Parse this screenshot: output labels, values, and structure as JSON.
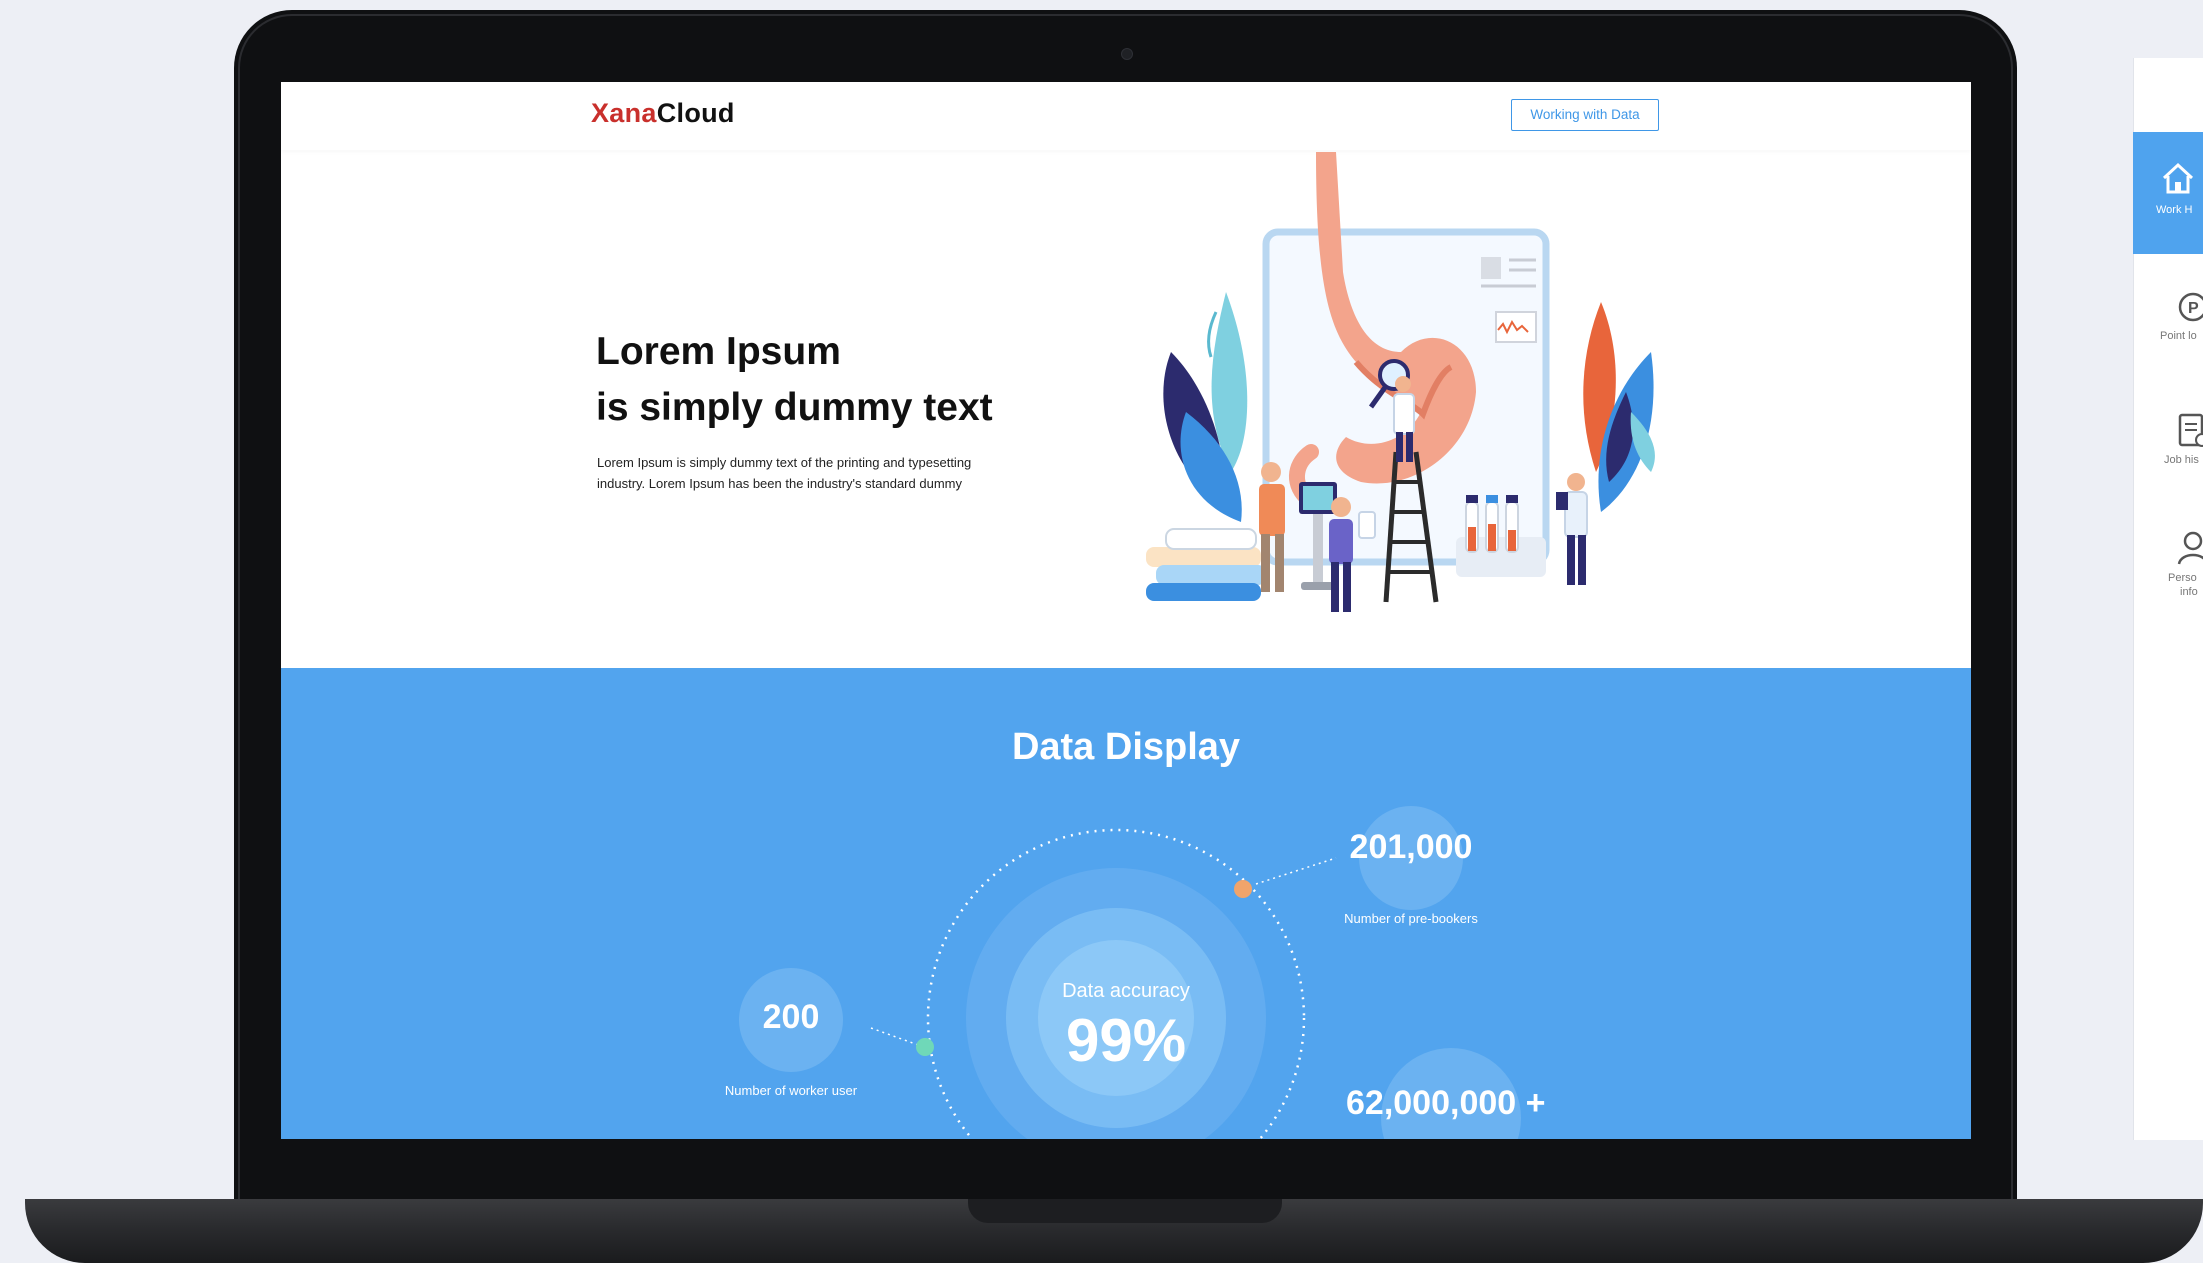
{
  "site": {
    "logo_prefix": "Xana",
    "logo_suffix": "Cloud",
    "nav_button": "Working with Data"
  },
  "hero": {
    "title_line1": "Lorem Ipsum",
    "title_line2": "is simply dummy text",
    "body": "Lorem Ipsum is simply dummy text of the printing and typesetting industry. Lorem Ipsum has been the industry's standard dummy"
  },
  "data_display": {
    "title": "Data Display",
    "accuracy_label": "Data accuracy",
    "accuracy_value": "99%",
    "stats": [
      {
        "value": "200",
        "label": "Number of worker user"
      },
      {
        "value": "201,000",
        "label": "Number of pre-bookers"
      },
      {
        "value": "62,000,000 +",
        "label": ""
      }
    ]
  },
  "side_app": {
    "items": [
      {
        "label": "Work H",
        "icon": "home-icon",
        "active": true
      },
      {
        "label": "Point lo",
        "icon": "point-icon",
        "active": false
      },
      {
        "label": "Job his",
        "icon": "document-icon",
        "active": false
      },
      {
        "label": "Perso",
        "label2": "info",
        "icon": "person-icon",
        "active": false
      }
    ]
  },
  "colors": {
    "accent": "#52a4ee",
    "logo_red": "#c9302c",
    "dot_orange": "#f0a46b",
    "dot_green": "#68d3b4"
  }
}
